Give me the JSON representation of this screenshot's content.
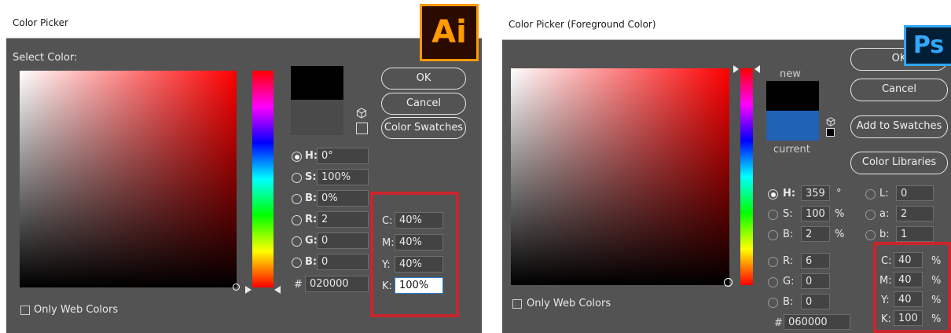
{
  "ai": {
    "title": "Color Picker",
    "logo_text": "Ai",
    "select_color_label": "Select Color:",
    "buttons": {
      "ok": "OK",
      "cancel": "Cancel",
      "swatches": "Color Swatches"
    },
    "fields": {
      "h": {
        "label": "H:",
        "value": "0°",
        "selected": true
      },
      "s": {
        "label": "S:",
        "value": "100%"
      },
      "b": {
        "label": "B:",
        "value": "0%"
      },
      "r": {
        "label": "R:",
        "value": "2"
      },
      "g": {
        "label": "G:",
        "value": "0"
      },
      "b2": {
        "label": "B:",
        "value": "0"
      },
      "hex": {
        "label": "#",
        "value": "020000"
      },
      "c": {
        "label": "C:",
        "value": "40%"
      },
      "m": {
        "label": "M:",
        "value": "40%"
      },
      "y": {
        "label": "Y:",
        "value": "40%"
      },
      "k": {
        "label": "K:",
        "value": "100%"
      }
    },
    "only_web_colors": "Only Web Colors",
    "colors": {
      "new_swatch": "#000000",
      "current_swatch": "#4a4a4a",
      "logo_bg": "#2b0a00",
      "logo_fg": "#ff9a00",
      "highlight": "#c8262c"
    }
  },
  "ps": {
    "title": "Color Picker (Foreground Color)",
    "logo_text": "Ps",
    "new_label": "new",
    "current_label": "current",
    "buttons": {
      "ok": "OK",
      "cancel": "Cancel",
      "add_swatches": "Add to Swatches",
      "libraries": "Color Libraries"
    },
    "fields": {
      "h": {
        "label": "H:",
        "value": "359",
        "unit": "°",
        "selected": true
      },
      "s": {
        "label": "S:",
        "value": "100",
        "unit": "%"
      },
      "b": {
        "label": "B:",
        "value": "2",
        "unit": "%"
      },
      "r": {
        "label": "R:",
        "value": "6"
      },
      "g": {
        "label": "G:",
        "value": "0"
      },
      "b2": {
        "label": "B:",
        "value": "0"
      },
      "l": {
        "label": "L:",
        "value": "0"
      },
      "a": {
        "label": "a:",
        "value": "2"
      },
      "lab_b": {
        "label": "b:",
        "value": "1"
      },
      "hex": {
        "label": "#",
        "value": "060000"
      },
      "c": {
        "label": "C:",
        "value": "40",
        "unit": "%"
      },
      "m": {
        "label": "M:",
        "value": "40",
        "unit": "%"
      },
      "y": {
        "label": "Y:",
        "value": "40",
        "unit": "%"
      },
      "k": {
        "label": "K:",
        "value": "100",
        "unit": "%"
      }
    },
    "only_web_colors": "Only Web Colors",
    "colors": {
      "new_swatch": "#000000",
      "current_swatch": "#1f62b4",
      "logo_bg": "#001e36",
      "logo_fg": "#31a8ff",
      "highlight": "#c8262c"
    }
  }
}
